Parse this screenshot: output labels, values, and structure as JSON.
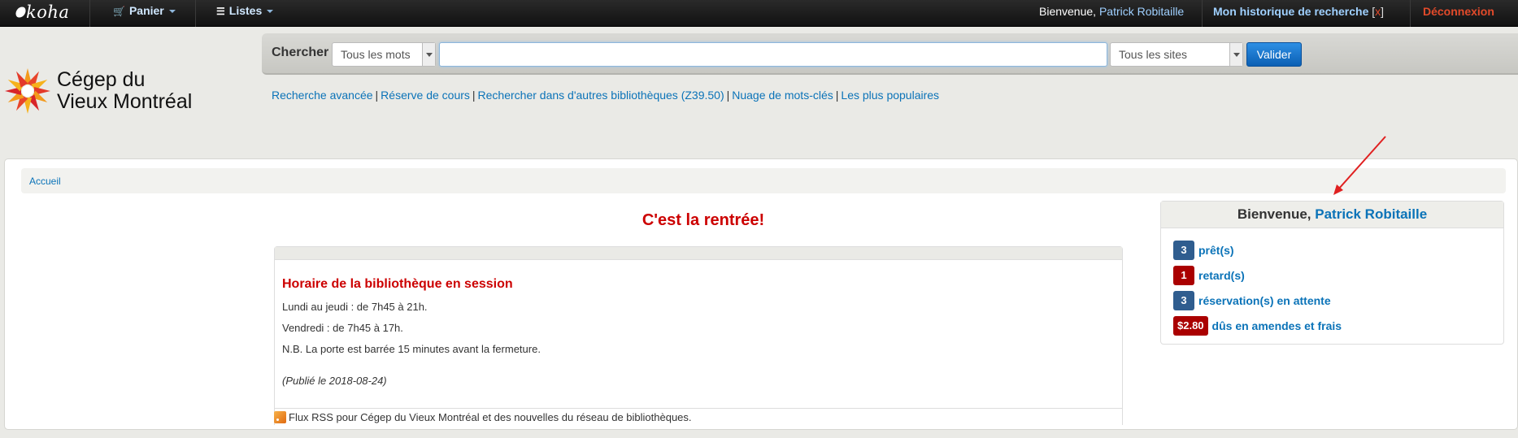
{
  "navbar": {
    "logo": "koha",
    "cart_label": "Panier",
    "lists_label": "Listes",
    "welcome_prefix": "Bienvenue,",
    "user_name": "Patrick Robitaille",
    "history_label": "Mon historique de recherche",
    "history_open": "[",
    "history_clear": "x",
    "history_close": "]",
    "logout_label": "Déconnexion",
    "cart_icon": "cart-icon",
    "lists_icon": "list-icon"
  },
  "brand": {
    "line1": "Cégep du",
    "line2": "Vieux Montréal"
  },
  "search": {
    "label": "Chercher",
    "index_selected": "Tous les mots",
    "query_value": "",
    "site_selected": "Tous les sites",
    "submit_label": "Valider"
  },
  "links": [
    "Recherche avancée",
    "Réserve de cours",
    "Rechercher dans d'autres bibliothèques (Z39.50)",
    "Nuage de mots-clés",
    "Les plus populaires"
  ],
  "link_separator": "|",
  "breadcrumb": {
    "home": "Accueil"
  },
  "news": {
    "title": "C'est la rentrée!",
    "item_title": "Horaire de la bibliothèque en session",
    "lines": [
      "Lundi au jeudi : de 7h45 à 21h.",
      "Vendredi : de 7h45 à 17h.",
      "N.B. La porte est barrée 15 minutes avant la fermeture."
    ],
    "published": "(Publié le 2018-08-24)",
    "rss_text": "Flux RSS pour Cégep du Vieux Montréal et des nouvelles du réseau de bibliothèques."
  },
  "user_summary": {
    "welcome": "Bienvenue,",
    "user_name": "Patrick Robitaille",
    "items": [
      {
        "count": "3",
        "label": "prêt(s)",
        "color": "#2f5d8f"
      },
      {
        "count": "1",
        "label": "retard(s)",
        "color": "#aa0000"
      },
      {
        "count": "3",
        "label": "réservation(s) en attente",
        "color": "#2f5d8f"
      },
      {
        "count": "$2.80",
        "label": "dûs en amendes et frais",
        "color": "#aa0000"
      }
    ]
  },
  "colors": {
    "link": "#0b73b8",
    "news_red": "#cc0000",
    "logout": "#e24a2a",
    "annotation_arrow": "#e02020"
  }
}
